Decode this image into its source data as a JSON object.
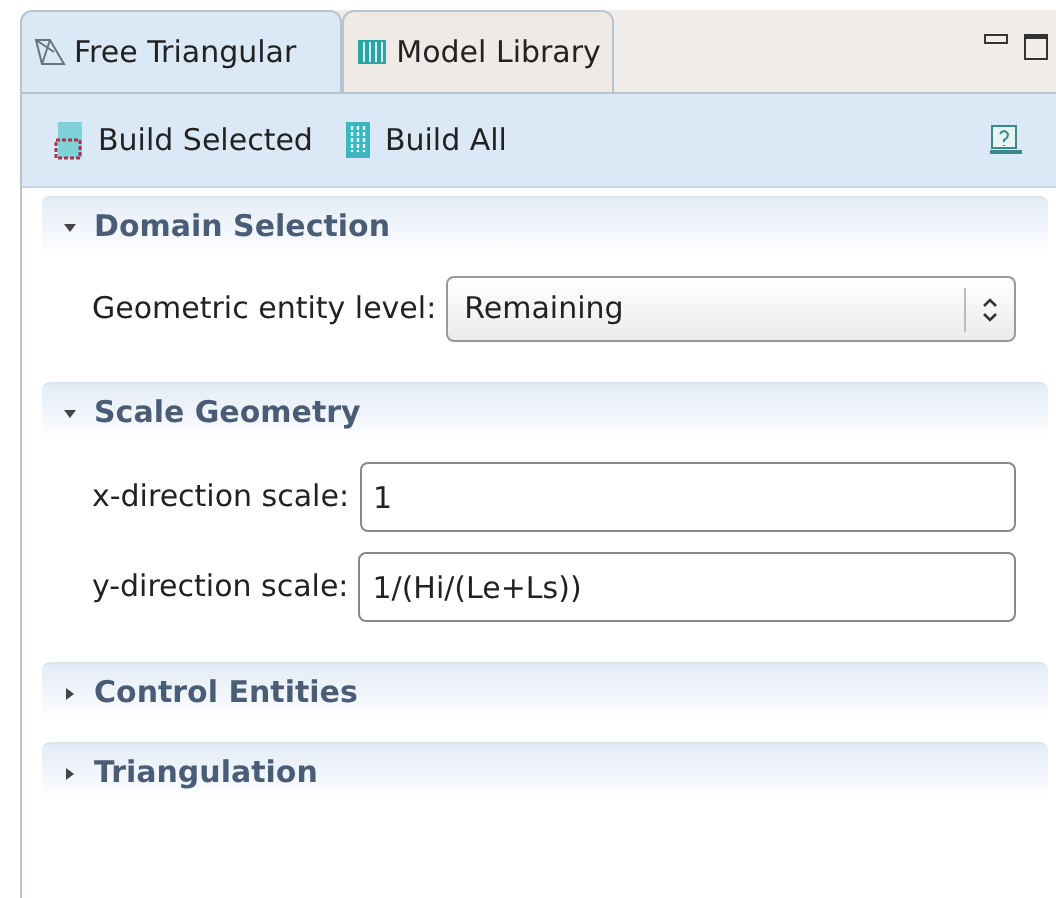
{
  "tabs": [
    {
      "label": "Free Triangular",
      "selected": true
    },
    {
      "label": "Model Library",
      "selected": false
    }
  ],
  "toolbar": {
    "buttons": [
      {
        "label": "Build Selected"
      },
      {
        "label": "Build All"
      }
    ]
  },
  "sections": [
    {
      "title": "Domain Selection",
      "expanded": true,
      "fields": [
        {
          "kind": "select",
          "label": "Geometric entity level:",
          "value": "Remaining"
        }
      ]
    },
    {
      "title": "Scale Geometry",
      "expanded": true,
      "fields": [
        {
          "kind": "text",
          "label": "x-direction scale:",
          "value": "1"
        },
        {
          "kind": "text",
          "label": "y-direction scale:",
          "value": "1/(Hi/(Le+Ls))"
        }
      ]
    },
    {
      "title": "Control Entities",
      "expanded": false
    },
    {
      "title": "Triangulation",
      "expanded": false
    }
  ]
}
